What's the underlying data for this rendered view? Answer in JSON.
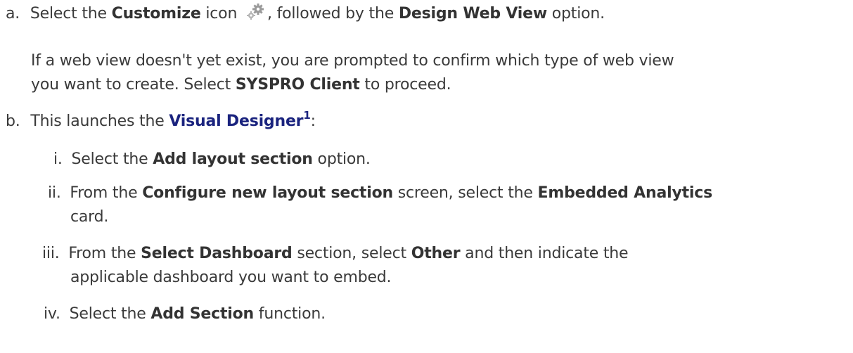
{
  "steps": {
    "a": {
      "marker": "a.",
      "t1": "Select the ",
      "b1": "Customize",
      "t2": " icon ",
      "icon": "gears-icon",
      "t3": ", followed by the ",
      "b2": "Design Web View",
      "t4": " option."
    },
    "a_note": {
      "line1": "If a web view doesn't yet exist, you are prompted to confirm which type of web view",
      "l2_t1": "you want to create. Select ",
      "l2_b1": "SYSPRO Client",
      "l2_t2": " to proceed."
    },
    "b": {
      "marker": "b.",
      "t1": "This launches the ",
      "link": "Visual Designer",
      "sup": "1",
      "t2": ":"
    },
    "i": {
      "marker": "i.",
      "t1": "Select the ",
      "b1": "Add layout section",
      "t2": " option."
    },
    "ii": {
      "marker": "ii.",
      "t1": "From the ",
      "b1": "Configure new layout section",
      "t2": " screen, select the ",
      "b2": "Embedded Analytics",
      "line2": "card."
    },
    "iii": {
      "marker": "iii.",
      "t1": "From the ",
      "b1": "Select Dashboard",
      "t2": " section, select ",
      "b2": "Other",
      "t3": " and then indicate the",
      "line2": "applicable dashboard you want to embed."
    },
    "iv": {
      "marker": "iv.",
      "t1": "Select the ",
      "b1": "Add Section",
      "t2": " function."
    }
  },
  "colors": {
    "text": "#3a3a3a",
    "link": "#1a237e"
  }
}
